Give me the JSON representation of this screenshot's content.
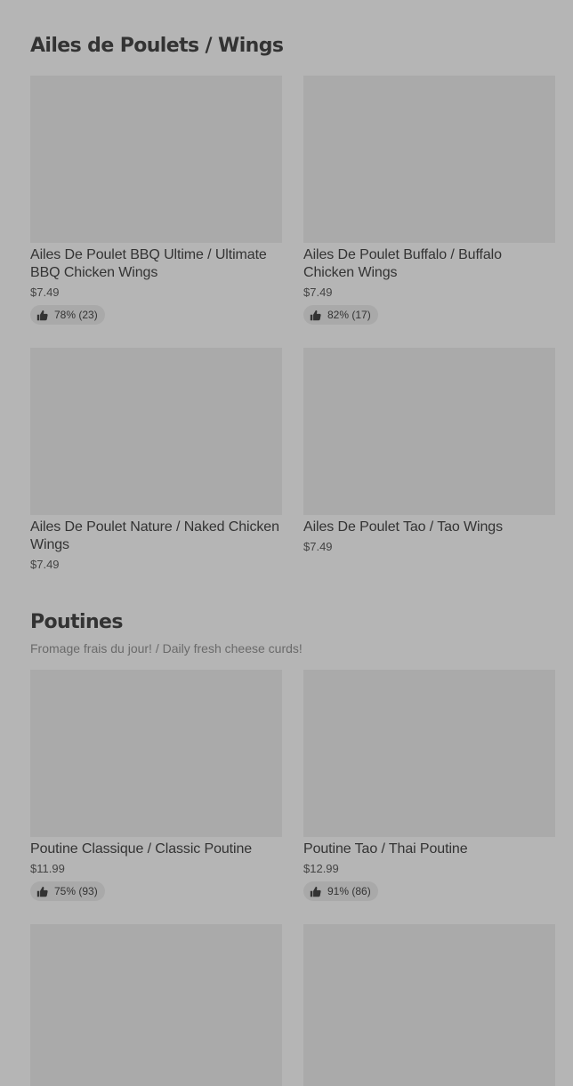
{
  "sections": [
    {
      "title": "Ailes de Poulets / Wings",
      "subtitle": "",
      "items": [
        {
          "name": "Ailes De Poulet BBQ Ultime / Ultimate BBQ Chicken Wings",
          "price": "$7.49",
          "rating": "78% (23)"
        },
        {
          "name": "Ailes De Poulet Buffalo / Buffalo Chicken Wings",
          "price": "$7.49",
          "rating": "82% (17)"
        },
        {
          "name": "Ailes De Poulet Nature / Naked Chicken Wings",
          "price": "$7.49",
          "rating": ""
        },
        {
          "name": "Ailes De Poulet Tao /  Tao Wings",
          "price": "$7.49",
          "rating": ""
        }
      ]
    },
    {
      "title": "Poutines",
      "subtitle": "Fromage frais du jour! / Daily fresh cheese curds!",
      "items": [
        {
          "name": "Poutine Classique / Classic Poutine",
          "price": "$11.99",
          "rating": "75% (93)"
        },
        {
          "name": "Poutine Tao  / Thai Poutine",
          "price": "$12.99",
          "rating": "91% (86)"
        },
        {
          "name": "",
          "price": "",
          "rating": ""
        },
        {
          "name": "",
          "price": "",
          "rating": ""
        }
      ]
    }
  ],
  "icons": {
    "rating": "thumbs-up-icon"
  },
  "colors": {
    "background": "#b5b5b5",
    "image_placeholder": "#aaaaaa",
    "badge": "#a9a9a9"
  }
}
